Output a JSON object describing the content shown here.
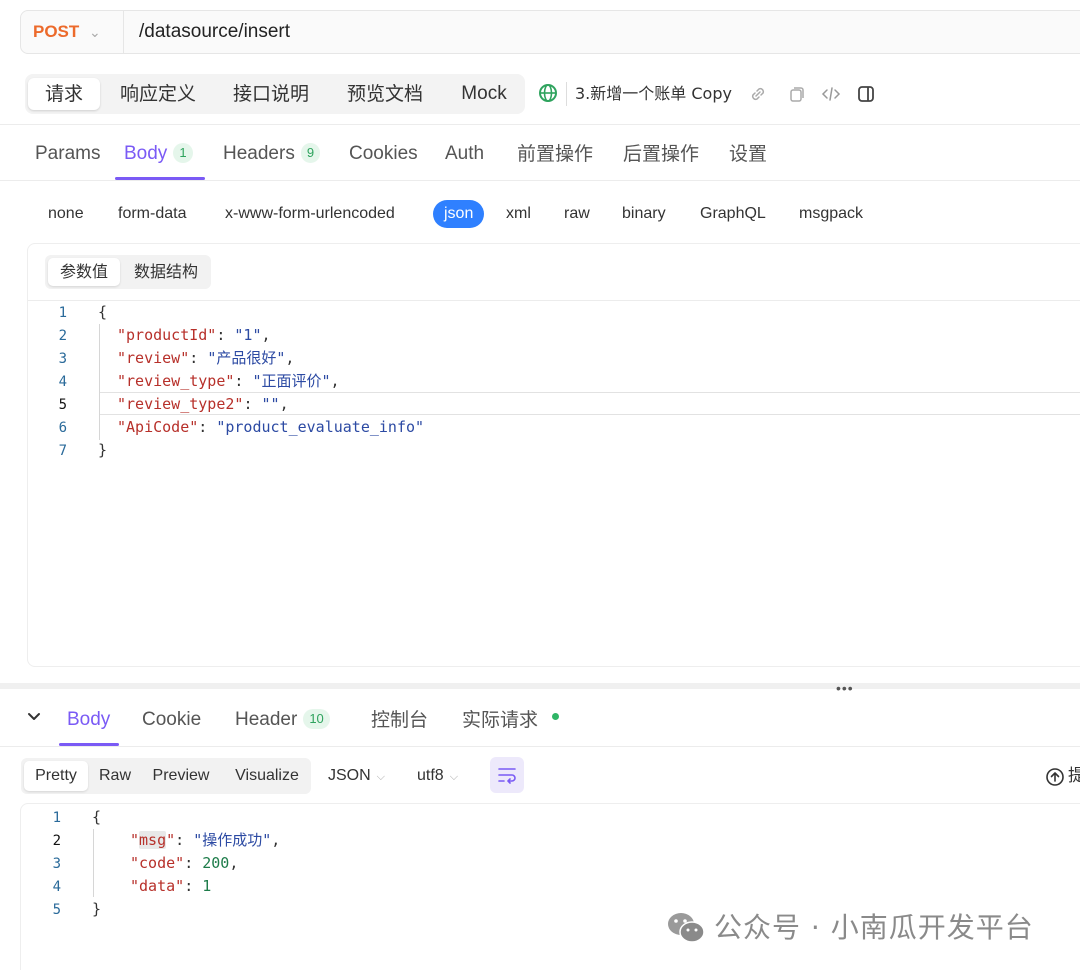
{
  "request": {
    "method": "POST",
    "url": "/datasource/insert"
  },
  "top_tabs": [
    {
      "label": "请求",
      "active": true
    },
    {
      "label": "响应定义"
    },
    {
      "label": "接口说明"
    },
    {
      "label": "预览文档"
    },
    {
      "label": "Mock"
    }
  ],
  "api_name": "3.新增一个账单 Copy",
  "request_tabs": {
    "params": "Params",
    "body": "Body",
    "body_count": "1",
    "headers": "Headers",
    "headers_count": "9",
    "cookies": "Cookies",
    "auth": "Auth",
    "pre_ops": "前置操作",
    "post_ops": "后置操作",
    "settings": "设置"
  },
  "body_types": [
    "none",
    "form-data",
    "x-www-form-urlencoded",
    "json",
    "xml",
    "raw",
    "binary",
    "GraphQL",
    "msgpack"
  ],
  "body_type_selected": "json",
  "editor_mode": {
    "values": "参数值",
    "schema": "数据结构"
  },
  "request_body": {
    "line_numbers": [
      "1",
      "2",
      "3",
      "4",
      "5",
      "6",
      "7"
    ],
    "open_brace": "{",
    "close_brace": "}",
    "fields": [
      {
        "key": "\"productId\"",
        "value": "\"1\"",
        "trail": ","
      },
      {
        "key": "\"review\"",
        "value": "\"产品很好\"",
        "trail": ","
      },
      {
        "key": "\"review_type\"",
        "value": "\"正面评价\"",
        "trail": ","
      },
      {
        "key": "\"review_type2\"",
        "value": "\"\"",
        "trail": ","
      },
      {
        "key": "\"ApiCode\"",
        "value": "\"product_evaluate_info\"",
        "trail": ""
      }
    ]
  },
  "response_tabs": {
    "body": "Body",
    "cookie": "Cookie",
    "header": "Header",
    "header_count": "10",
    "console": "控制台",
    "actual_request": "实际请求"
  },
  "response_toolbar": {
    "formats": [
      "Pretty",
      "Raw",
      "Preview",
      "Visualize"
    ],
    "format_selected": "Pretty",
    "language": "JSON",
    "encoding": "utf8",
    "export_label": "提"
  },
  "response_body": {
    "line_numbers": [
      "1",
      "2",
      "3",
      "4",
      "5"
    ],
    "open_brace": "{",
    "close_brace": "}",
    "msg_quote_open": "\"",
    "msg_key": "msg",
    "msg_quote_close": "\"",
    "msg_value": "\"操作成功\"",
    "code_key": "\"code\"",
    "code_value": "200",
    "data_key": "\"data\"",
    "data_value": "1"
  },
  "watermark": "公众号 · 小南瓜开发平台",
  "colors": {
    "accent": "#7a5af5",
    "method": "#ec6a2b",
    "json_active": "#2f80ff",
    "status_dot": "#2fb566"
  }
}
